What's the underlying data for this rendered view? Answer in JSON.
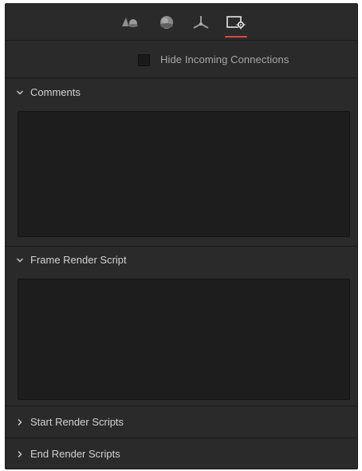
{
  "tabs": [
    {
      "icon": "shapes-icon",
      "active": false
    },
    {
      "icon": "material-sphere-icon",
      "active": false
    },
    {
      "icon": "transform-axes-icon",
      "active": false
    },
    {
      "icon": "settings-icon",
      "active": true
    }
  ],
  "accent_color": "#e0443c",
  "option": {
    "label": "Hide Incoming Connections",
    "checked": false
  },
  "sections": {
    "comments": {
      "title": "Comments",
      "expanded": true,
      "value": ""
    },
    "frame_render_script": {
      "title": "Frame Render Script",
      "expanded": true,
      "value": ""
    },
    "start_render_scripts": {
      "title": "Start Render Scripts",
      "expanded": false
    },
    "end_render_scripts": {
      "title": "End Render Scripts",
      "expanded": false
    }
  }
}
